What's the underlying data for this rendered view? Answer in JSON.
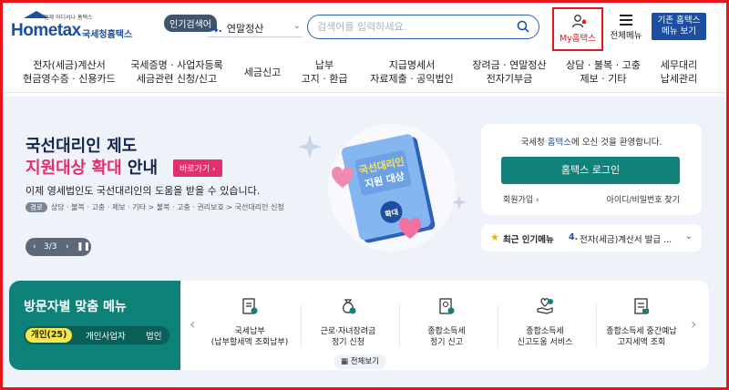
{
  "header": {
    "logo": {
      "word": "Hometax",
      "korean": "국세청홈택스",
      "tagline": "언제 어디서나 홈택스"
    },
    "popular_badge": "인기검색어",
    "popular_rank": {
      "num": "4.",
      "text": "연말정산"
    },
    "search": {
      "placeholder": "검색어를 입력하세요."
    },
    "my_hometax": "My홈택스",
    "all_menu": "전체메뉴",
    "old_view": {
      "line1": "기존 홈택스",
      "line2": "메뉴 보기"
    }
  },
  "gnb": [
    {
      "l1": "전자(세금)계산서",
      "l2": "현금영수증 · 신용카드"
    },
    {
      "l1": "국세증명 · 사업자등록",
      "l2": "세금관련 신청/신고"
    },
    {
      "l1": "세금신고",
      "l2": ""
    },
    {
      "l1": "납부",
      "l2": "고지 · 환급"
    },
    {
      "l1": "지급명세서",
      "l2": "자료제출 · 공익법인"
    },
    {
      "l1": "장려금 · 연말정산",
      "l2": "전자기부금"
    },
    {
      "l1": "상담 · 불복 · 고충",
      "l2": "제보 · 기타"
    },
    {
      "l1": "세무대리",
      "l2": "납세관리"
    }
  ],
  "banner": {
    "title1": "국선대리인 제도",
    "title2_red": "지원대상 확대",
    "title2_dark": " 안내",
    "shortcut": "바로가기 ›",
    "desc": "이제 영세법인도 국선대리인의 도움을 받을 수 있습니다.",
    "path_tag": "경로",
    "path": "상담 · 불복 · 고충 · 제보 · 기타 > 불복 · 고충 · 권리보호 > 국선대리인 신청",
    "pager": {
      "prev": "‹",
      "count": "3/3",
      "next": "›",
      "pause": "❚❚"
    },
    "illus_book": "국선대리인\n지원 대상",
    "illus_tag": "확대"
  },
  "login": {
    "welcome_pre": "국세청 ",
    "welcome_brand": "홈택스",
    "welcome_post": "에 오신 것을 환영합니다.",
    "button": "홈택스 로그인",
    "join": "회원가입 ›",
    "find": "아이디/비밀번호 찾기"
  },
  "popular_menu": {
    "title": "최근 인기메뉴",
    "num": "4.",
    "text": "전자(세금)계산서 발급 ...",
    "chev": "⌄"
  },
  "visitor": {
    "title": "방문자별 맞춤 메뉴",
    "tabs": [
      "개인(25)",
      "개인사업자",
      "법인"
    ],
    "cards": [
      {
        "l1": "국세납부",
        "l2": "(납부할세액 조회납부)"
      },
      {
        "l1": "근로·자녀장려금",
        "l2": "정기 신청"
      },
      {
        "l1": "종합소득세",
        "l2": "정기 신고"
      },
      {
        "l1": "종합소득세",
        "l2": "신고도움 서비스"
      },
      {
        "l1": "종합소득세 중간예납",
        "l2": "고지세액 조회"
      }
    ],
    "view_all": "전체보기"
  },
  "colors": {
    "brand_blue": "#1c4fa1",
    "teal": "#12817a",
    "accent_red": "#e8141b",
    "pink": "#e1306c"
  }
}
